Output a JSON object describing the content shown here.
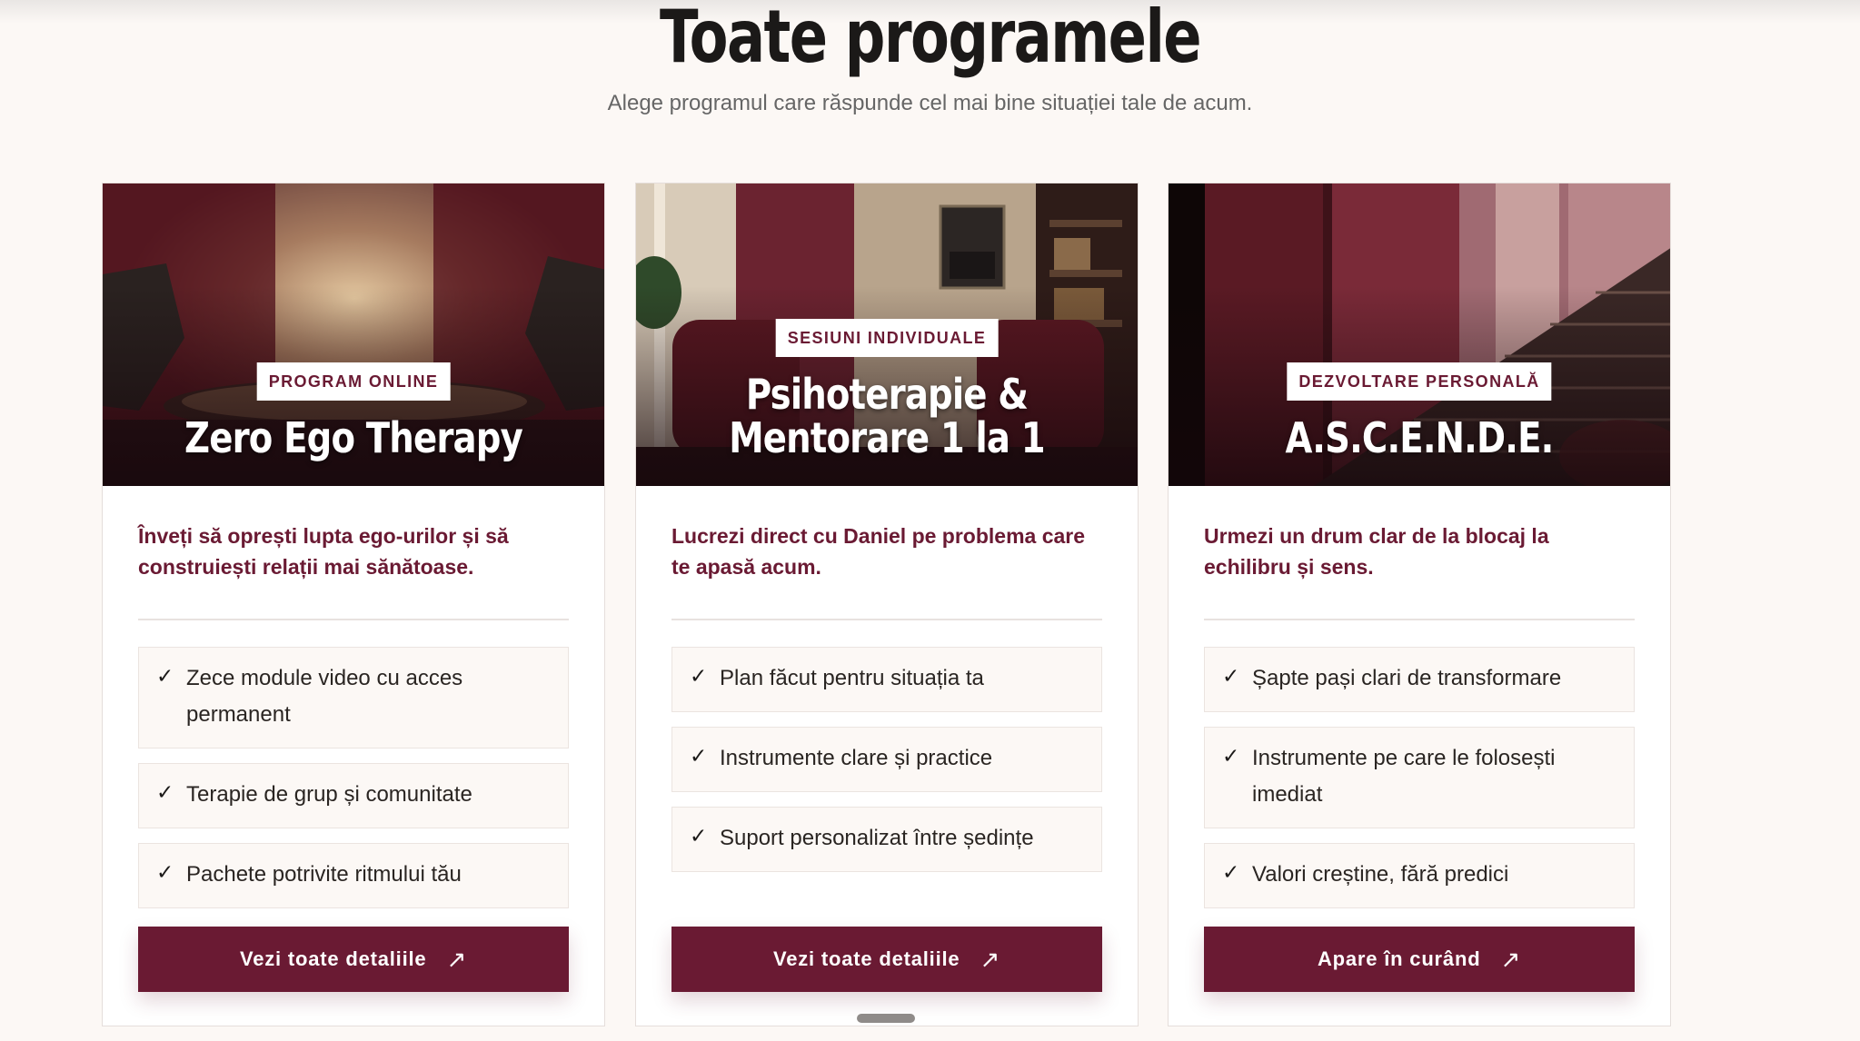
{
  "header": {
    "title": "Toate programele",
    "subtitle": "Alege programul care răspunde cel mai bine situației tale de acum."
  },
  "colors": {
    "accent": "#6a1a33",
    "background": "#fcf8f5",
    "card": "#ffffff"
  },
  "cards": [
    {
      "badge": "PROGRAM ONLINE",
      "title": "Zero Ego Therapy",
      "lead": "Înveți să oprești lupta ego-urilor și să construiești relații mai sănătoase.",
      "features": [
        "Zece module video cu acces permanent",
        "Terapie de grup și comunitate",
        "Pachete potrivite ritmului tău"
      ],
      "button": "Vezi toate detaliile",
      "button_icon": "arrow-up-right-icon"
    },
    {
      "badge": "SESIUNI INDIVIDUALE",
      "title": "Psihoterapie & Mentorare 1 la 1",
      "lead": "Lucrezi direct cu Daniel pe problema care te apasă acum.",
      "features": [
        "Plan făcut pentru situația ta",
        "Instrumente clare și practice",
        "Suport personalizat între ședințe"
      ],
      "button": "Vezi toate detaliile",
      "button_icon": "arrow-up-right-icon"
    },
    {
      "badge": "DEZVOLTARE PERSONALĂ",
      "title": "A.S.C.E.N.D.E.",
      "lead": "Urmezi un drum clar de la blocaj la echilibru și sens.",
      "features": [
        "Șapte pași clari de transformare",
        "Instrumente pe care le folosești imediat",
        "Valori creștine, fără predici"
      ],
      "button": "Apare în curând",
      "button_icon": "arrow-up-right-icon"
    }
  ],
  "icons": {
    "check": "✓",
    "arrow": "↗"
  }
}
